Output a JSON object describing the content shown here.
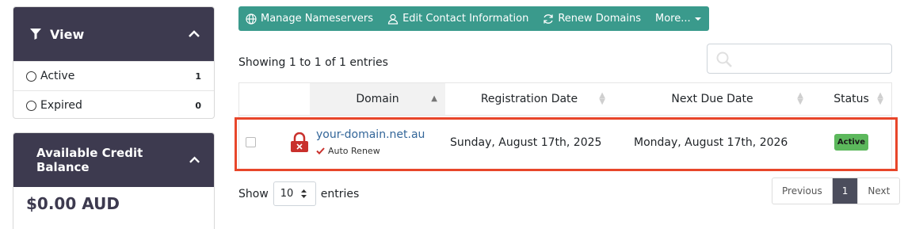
{
  "sidebar": {
    "view": {
      "title": "View",
      "filters": [
        {
          "label": "Active",
          "count": "1"
        },
        {
          "label": "Expired",
          "count": "0"
        }
      ]
    },
    "credit": {
      "title": "Available Credit Balance",
      "amount": "$0.00 AUD"
    }
  },
  "toolbar": {
    "manage_ns": "Manage Nameservers",
    "edit_contact": "Edit Contact Information",
    "renew": "Renew Domains",
    "more": "More..."
  },
  "listing": {
    "showing": "Showing 1 to 1 of 1 entries",
    "search_placeholder": ""
  },
  "table": {
    "columns": [
      "Domain",
      "Registration Date",
      "Next Due Date",
      "Status"
    ],
    "rows": [
      {
        "domain": "your-domain.net.au",
        "auto_renew": "Auto Renew",
        "registration_date": "Sunday, August 17th, 2025",
        "next_due_date": "Monday, August 17th, 2026",
        "status": "Active"
      }
    ]
  },
  "footer": {
    "show": "Show",
    "page_size": "10",
    "entries": "entries",
    "prev": "Previous",
    "page": "1",
    "next": "Next"
  },
  "colors": {
    "sidebar_header": "#3d3a4f",
    "toolbar": "#3a9a8c",
    "highlight": "#e8462a",
    "status_active": "#5cb85c",
    "link": "#336699"
  }
}
